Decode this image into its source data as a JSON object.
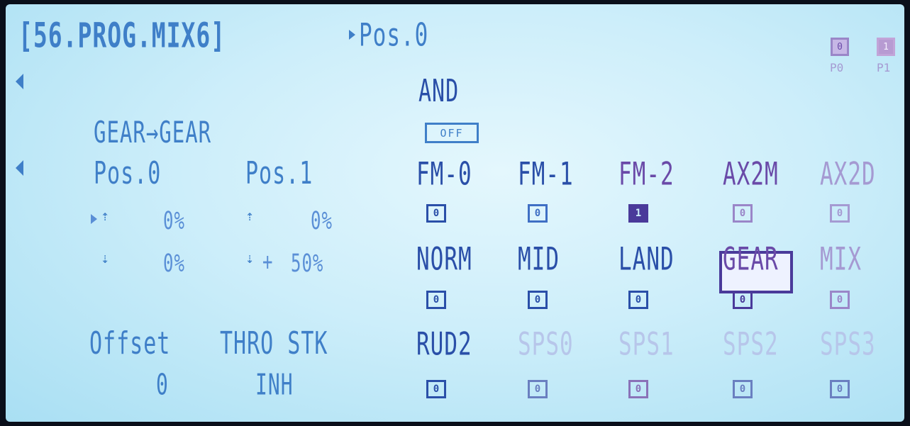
{
  "header": {
    "title": "[56.PROG.MIX6]",
    "position": "Pos.0"
  },
  "positions": {
    "p0_label": "P0",
    "p0_value": "0",
    "p1_label": "P1",
    "p1_value": "1"
  },
  "logic": {
    "mode": "AND",
    "state": "OFF"
  },
  "mix": {
    "route": "GEAR→GEAR",
    "pos0_label": "Pos.0",
    "pos1_label": "Pos.1",
    "up_p0": "0%",
    "up_p1": "0%",
    "dn_p0": "0%",
    "dn_p1_plus": "+",
    "dn_p1": "50%",
    "offset_label": "Offset",
    "offset_value": "0",
    "thro_stk_label": "THRO STK",
    "thro_stk_value": "INH"
  },
  "switches": [
    {
      "label": "FM-0",
      "value": "0"
    },
    {
      "label": "FM-1",
      "value": "0"
    },
    {
      "label": "FM-2",
      "value": "1"
    },
    {
      "label": "AX2M",
      "value": "0"
    },
    {
      "label": "AX2D",
      "value": "0"
    },
    {
      "label": "NORM",
      "value": "0"
    },
    {
      "label": "MID",
      "value": "0"
    },
    {
      "label": "LAND",
      "value": "0"
    },
    {
      "label": "GEAR",
      "value": "0"
    },
    {
      "label": "MIX",
      "value": "0"
    },
    {
      "label": "RUD2",
      "value": "0"
    },
    {
      "label": "SPS0",
      "value": "0"
    },
    {
      "label": "SPS1",
      "value": "0"
    },
    {
      "label": "SPS2",
      "value": "0"
    },
    {
      "label": "SPS3",
      "value": "0"
    }
  ],
  "icons": {
    "stick_up": "stick-up-icon",
    "stick_down": "stick-down-icon",
    "cursor": "cursor-caret-icon",
    "scroll": "scroll-left-arrow-icon"
  },
  "colors": {
    "lcd_bg": "#cdeefa",
    "text": "#3f7fc8",
    "dark": "#2a4fa8",
    "purple": "#6a4aa8",
    "ghost": "#b7c6ea"
  }
}
